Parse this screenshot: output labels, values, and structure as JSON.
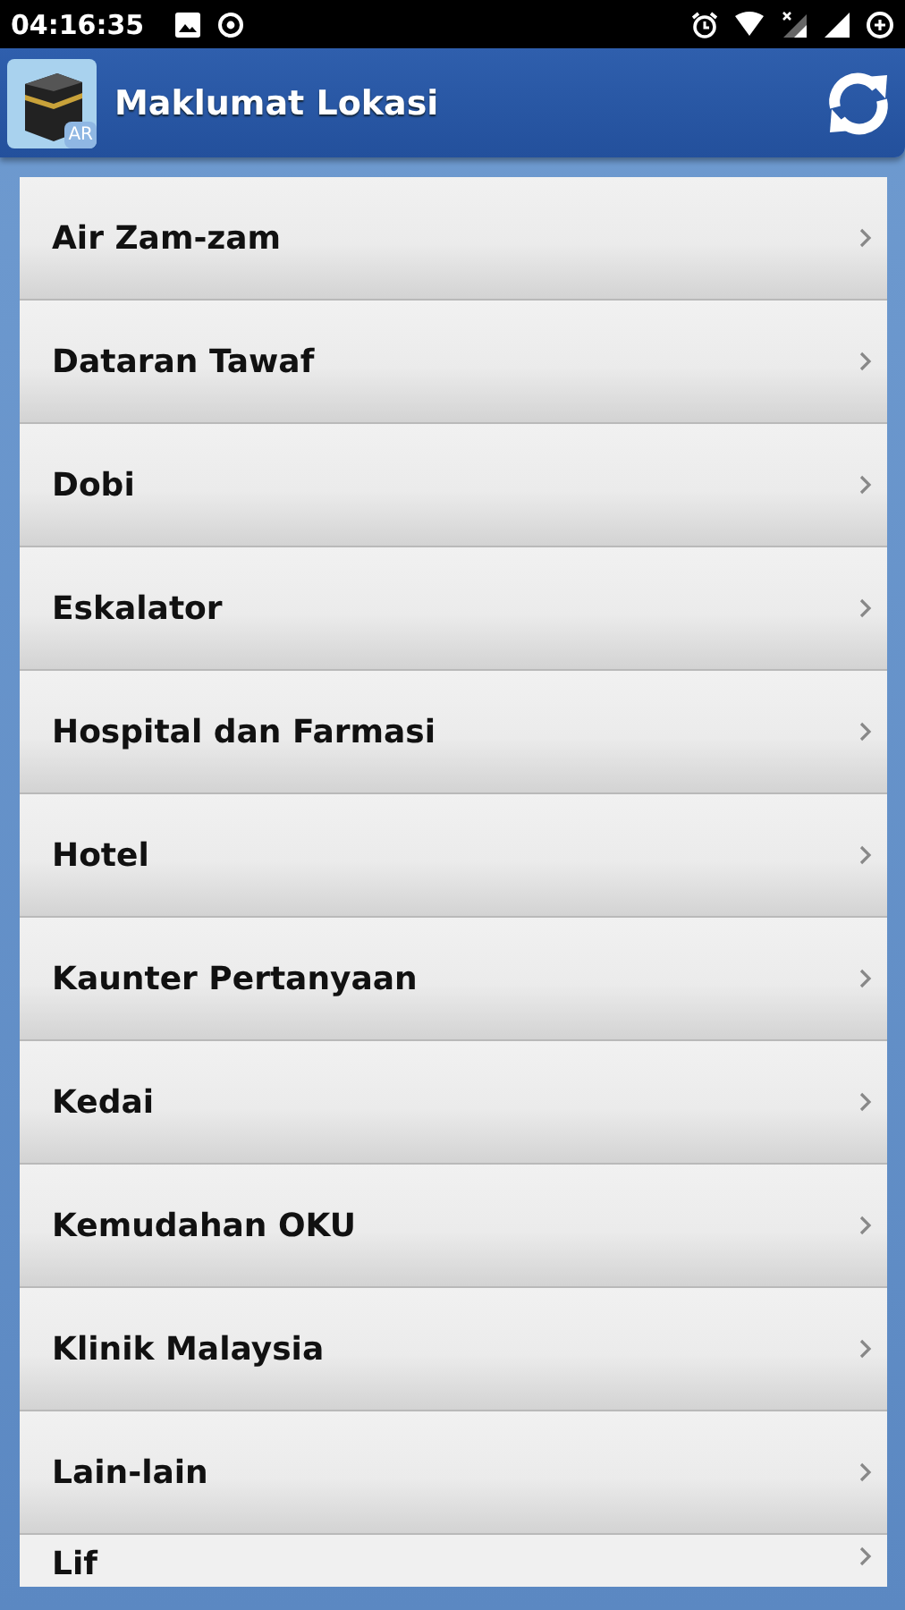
{
  "status_bar": {
    "time": "04:16:35"
  },
  "app_bar": {
    "title": "Maklumat Lokasi",
    "icon_badge": "AR"
  },
  "items": [
    {
      "label": "Air Zam-zam"
    },
    {
      "label": "Dataran Tawaf"
    },
    {
      "label": "Dobi"
    },
    {
      "label": "Eskalator"
    },
    {
      "label": "Hospital dan Farmasi"
    },
    {
      "label": "Hotel"
    },
    {
      "label": "Kaunter Pertanyaan"
    },
    {
      "label": "Kedai"
    },
    {
      "label": "Kemudahan OKU"
    },
    {
      "label": "Klinik Malaysia"
    },
    {
      "label": "Lain-lain"
    },
    {
      "label": "Lif"
    }
  ]
}
